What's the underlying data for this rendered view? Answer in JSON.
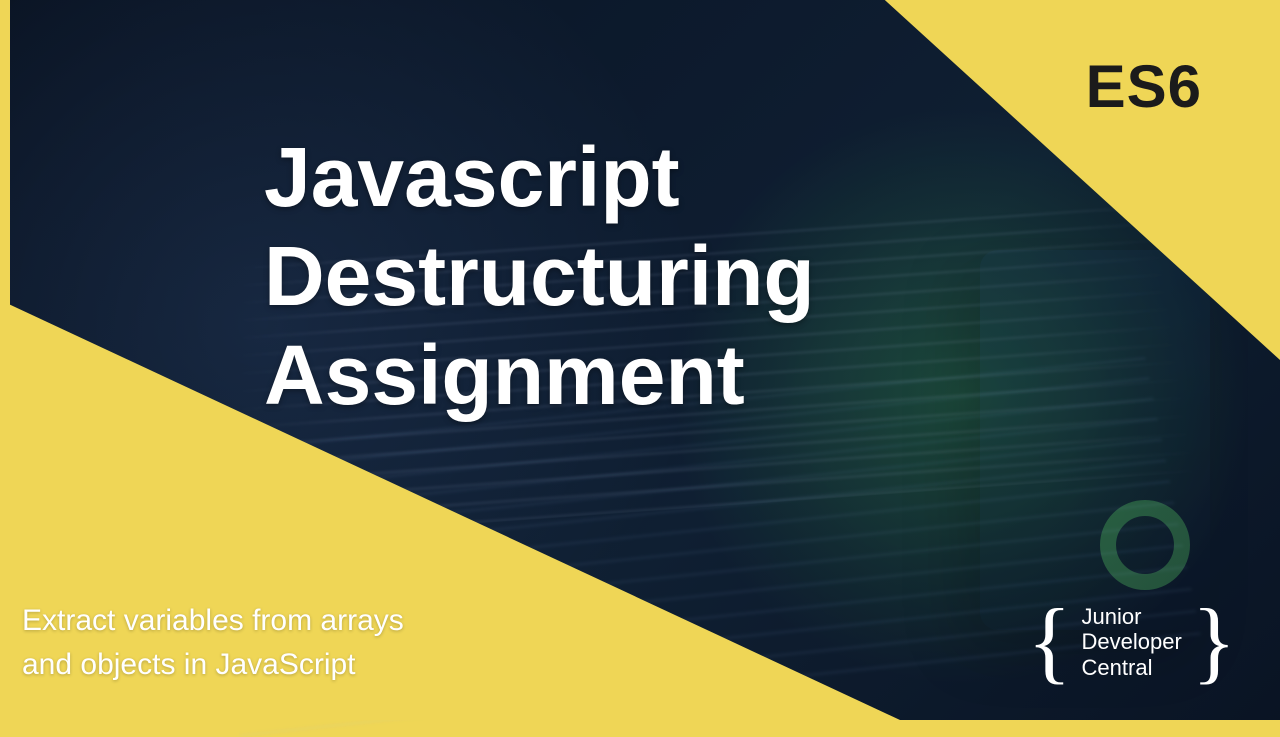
{
  "badge": "ES6",
  "title": "Javascript\nDestructuring\nAssignment",
  "subtitle": "Extract variables from arrays\nand objects in JavaScript",
  "logo": {
    "line1": "Junior",
    "line2": "Developer",
    "line3": "Central"
  },
  "colors": {
    "accent": "#efd656",
    "text_light": "#ffffff",
    "text_dark": "#1b1b1b"
  }
}
